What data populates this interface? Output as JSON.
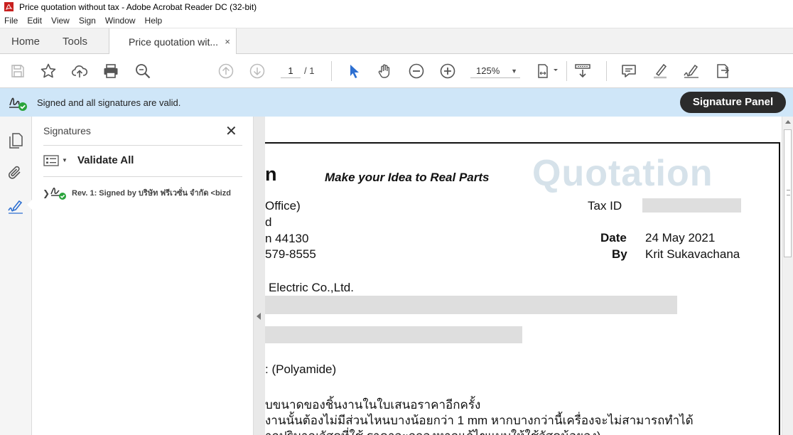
{
  "window": {
    "title": "Price quotation without tax - Adobe Acrobat Reader DC (32-bit)"
  },
  "menu": [
    "File",
    "Edit",
    "View",
    "Sign",
    "Window",
    "Help"
  ],
  "tabs": {
    "home": "Home",
    "tools": "Tools",
    "doc": "Price quotation wit...",
    "close": "×"
  },
  "toolbar": {
    "page_current": "1",
    "page_total": "/ 1",
    "zoom": "125%",
    "zoom_dropdown": "▼"
  },
  "banner": {
    "message": "Signed and all signatures are valid.",
    "button": "Signature Panel"
  },
  "signatures_pane": {
    "title": "Signatures",
    "close": "✕",
    "validate_all": "Validate All",
    "options_dropdown": "▼",
    "revision_chevron": "❯",
    "revision": "Rev. 1: Signed by บริษัท ฟรีเวซั่น จำกัด <bizd"
  },
  "document": {
    "heading": "n",
    "tagline": "Make your Idea to Real Parts",
    "watermark": "Quotation",
    "line_office": "Office)",
    "line_d": "d",
    "line_postcode": "n 44130",
    "line_phone": "579-8555",
    "tax_id_label": "Tax ID",
    "date_label": "Date",
    "date_value": "24 May 2021",
    "by_label": "By",
    "by_value": "Krit Sukavachana",
    "customer": "Electric Co.,Ltd.",
    "material": ": (Polyamide)",
    "thai_line1": "บขนาดของชิ้นงานในใบเสนอราคาอีกครั้ง",
    "thai_line2": "งานนั้นต้องไม่มีส่วนไหนบางน้อยกว่า 1 mm หากบางกว่านี้เครื่องจะไม่สามารถทำได้",
    "thai_line3": "ากปริมาณวัสดุที่ใช้ ราคาจะถูกลงหากแก้ไขแบบให้ใช้วัสดุน้อยลง)"
  },
  "colors": {
    "banner": "#cfe6f8",
    "accent_blue": "#2d6fd1",
    "valid_green": "#2aa43c",
    "watermark": "#d6e2ea"
  }
}
